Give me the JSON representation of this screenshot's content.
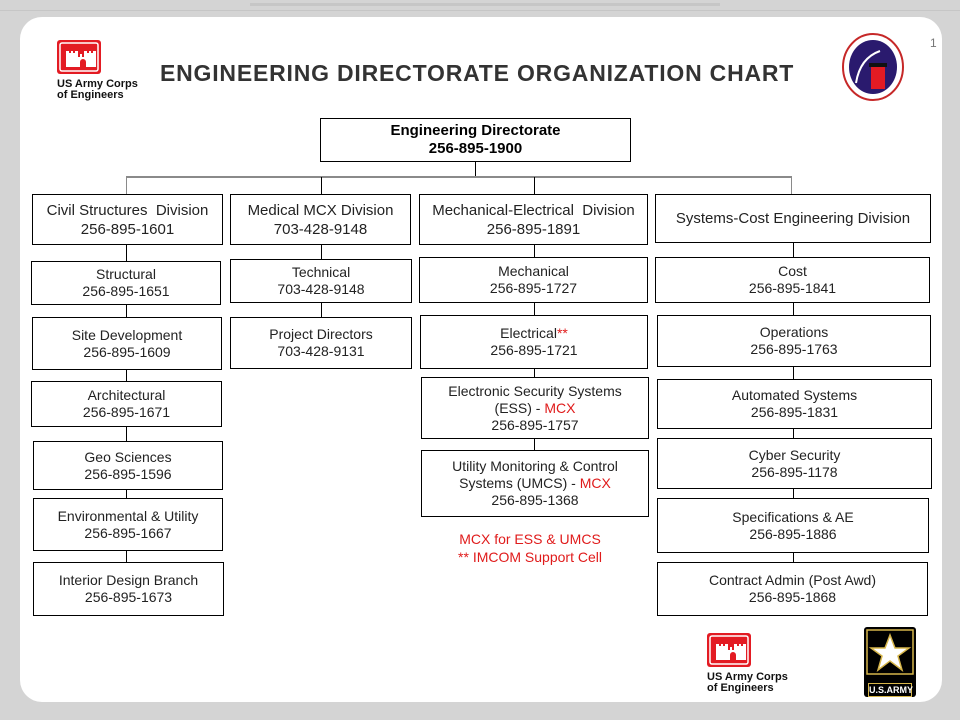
{
  "title": "ENGINEERING DIRECTORATE ORGANIZATION CHART",
  "page_number": "1",
  "logos": {
    "usace_line1": "US Army Corps",
    "usace_line2": "of Engineers",
    "army_label": "U.S.ARMY",
    "seal_alt": "U.S. Army Corps of Engineers Engineering and Support Center, Huntsville seal"
  },
  "colors": {
    "accent_red": "#e01b1b",
    "usace_red": "#e31b23",
    "seal_blue": "#2a1a6e"
  },
  "top": {
    "name": "Engineering Directorate",
    "phone": "256-895-1900"
  },
  "divisions": [
    {
      "name": "Civil Structures  Division",
      "phone": "256-895-1601",
      "branches": [
        {
          "name": "Structural",
          "phone": "256-895-1651"
        },
        {
          "name": "Site Development",
          "phone": "256-895-1609"
        },
        {
          "name": "Architectural",
          "phone": "256-895-1671"
        },
        {
          "name": "Geo Sciences",
          "phone": "256-895-1596"
        },
        {
          "name": "Environmental & Utility",
          "phone": "256-895-1667"
        },
        {
          "name": "Interior Design Branch",
          "phone": "256-895-1673"
        }
      ]
    },
    {
      "name": "Medical MCX Division",
      "phone": "703-428-9148",
      "branches": [
        {
          "name": "Technical",
          "phone": "703-428-9148"
        },
        {
          "name": "Project Directors",
          "phone": "703-428-9131"
        }
      ]
    },
    {
      "name": "Mechanical-Electrical  Division",
      "phone": "256-895-1891",
      "branches": [
        {
          "name": "Mechanical",
          "phone": "256-895-1727"
        },
        {
          "name": "Electrical",
          "mark": "**",
          "phone": "256-895-1721"
        },
        {
          "name": "Electronic Security Systems",
          "name2": "(ESS) - ",
          "mark": "MCX",
          "phone": "256-895-1757"
        },
        {
          "name": "Utility Monitoring & Control",
          "name2": "Systems (UMCS) - ",
          "mark": "MCX",
          "phone": "256-895-1368"
        }
      ]
    },
    {
      "name": "Systems-Cost Engineering Division",
      "phone": "",
      "branches": [
        {
          "name": "Cost",
          "phone": "256-895-1841"
        },
        {
          "name": "Operations",
          "phone": "256-895-1763"
        },
        {
          "name": "Automated Systems",
          "phone": "256-895-1831"
        },
        {
          "name": "Cyber Security",
          "phone": "256-895-1178"
        },
        {
          "name": "Specifications & AE",
          "phone": "256-895-1886"
        },
        {
          "name": "Contract Admin (Post Awd)",
          "phone": "256-895-1868"
        }
      ]
    }
  ],
  "notes": [
    "MCX for ESS & UMCS",
    "** IMCOM  Support Cell"
  ]
}
